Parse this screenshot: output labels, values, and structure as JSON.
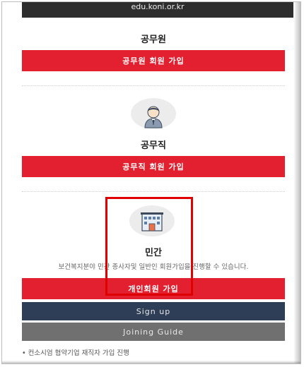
{
  "browser": {
    "url": "edu.koni.or.kr"
  },
  "sections": {
    "official": {
      "title": "공무원",
      "button": "공무원 회원 가입"
    },
    "public_servant": {
      "title": "공무직",
      "button": "공무직 회원 가입"
    },
    "private": {
      "title": "민간",
      "description": "보건복지분야 민간 종사자및 일반인 회원가입을 진행할 수 있습니다.",
      "button": "개인회원 가입"
    }
  },
  "buttons": {
    "signup": "Sign up",
    "joining_guide": "Joining Guide"
  },
  "note": "• 컨소시엄 협약기업 재직자 가입 진행",
  "colors": {
    "primary_red": "#e3202f",
    "navy": "#2f3e57",
    "gray": "#707070",
    "highlight": "#e00000"
  }
}
